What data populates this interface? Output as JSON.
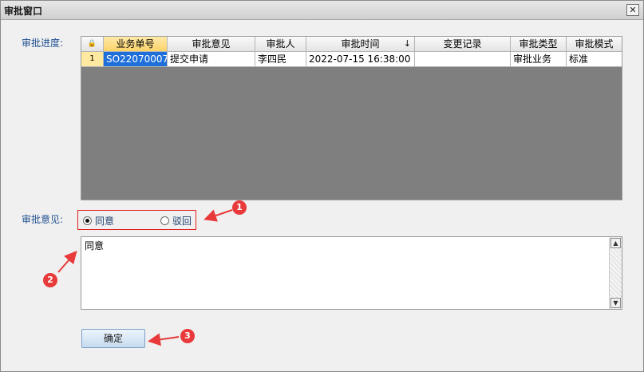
{
  "window": {
    "title": "审批窗口",
    "close_glyph": "✕"
  },
  "labels": {
    "progress": "审批进度:",
    "opinion": "审批意见:"
  },
  "grid": {
    "lock_glyph": "🔒",
    "columns": [
      "业务单号",
      "审批意见",
      "审批人",
      "审批时间",
      "变更记录",
      "审批类型",
      "审批模式"
    ],
    "sort_glyph": "↓",
    "rows": [
      {
        "num": "1",
        "cells": [
          "SO22070007",
          "提交申请",
          "李四民",
          "2022-07-15 16:38:00",
          "",
          "审批业务",
          "标准"
        ]
      }
    ]
  },
  "decision": {
    "options": [
      {
        "label": "同意",
        "selected": true
      },
      {
        "label": "驳回",
        "selected": false
      }
    ]
  },
  "comment": {
    "value": "同意"
  },
  "scroll": {
    "up": "▲",
    "down": "▼"
  },
  "actions": {
    "confirm_label": "确定"
  },
  "callouts": [
    "1",
    "2",
    "3"
  ],
  "colors": {
    "accent": "#1e6fd9",
    "callout": "#e83a3a",
    "grid_empty": "#7f7f7f"
  }
}
